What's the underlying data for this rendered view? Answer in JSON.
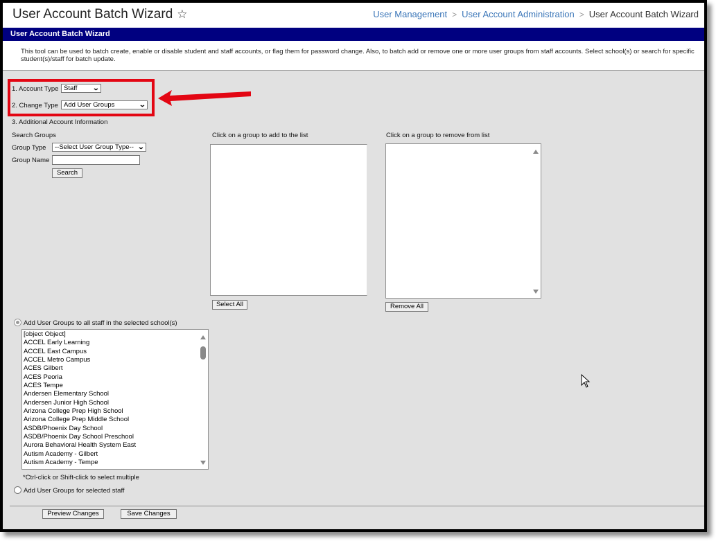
{
  "header": {
    "title": "User Account Batch Wizard",
    "favorite_icon": "star-outline-icon",
    "breadcrumb": [
      {
        "label": "User Management",
        "link": true
      },
      {
        "label": "User Account Administration",
        "link": true
      },
      {
        "label": "User Account Batch Wizard",
        "link": false
      }
    ],
    "breadcrumb_separator": ">"
  },
  "section": {
    "title": "User Account Batch Wizard",
    "header_color": "#000080",
    "description": "This tool can be used to batch create, enable or disable student and staff accounts, or flag them for password change. Also, to batch add or remove one or more user groups from staff accounts. Select school(s) or search for specific student(s)/staff for batch update."
  },
  "form": {
    "account_type": {
      "label": "1. Account Type",
      "value": "Staff"
    },
    "change_type": {
      "label": "2. Change Type",
      "value": "Add User Groups"
    },
    "additional_info_label": "3. Additional Account Information",
    "search_groups": {
      "title": "Search Groups",
      "group_type_label": "Group Type",
      "group_type_value": "--Select User Group Type--",
      "group_name_label": "Group Name",
      "group_name_value": "",
      "search_button": "Search"
    },
    "add_list": {
      "label": "Click on a group to add to the list",
      "button": "Select All",
      "items": []
    },
    "remove_list": {
      "label": "Click on a group to remove from list",
      "button": "Remove All",
      "items": []
    },
    "scope_options": [
      {
        "label": "Add User Groups to all staff in the selected school(s)",
        "checked": true
      },
      {
        "label": "Add User Groups for selected staff",
        "checked": false
      }
    ],
    "schools": [
      "[object Object]",
      "ACCEL Early Learning",
      "ACCEL East Campus",
      "ACCEL Metro Campus",
      "ACES Gilbert",
      "ACES Peoria",
      "ACES Tempe",
      "Andersen Elementary School",
      "Andersen Junior High School",
      "Arizona College Prep High School",
      "Arizona College Prep Middle School",
      "ASDB/Phoenix Day School",
      "ASDB/Phoenix Day School Preschool",
      "Aurora Behavioral Health System East",
      "Autism Academy - Gilbert",
      "Autism Academy - Tempe"
    ],
    "multi_select_hint": "*Ctrl-click or Shift-click to select multiple"
  },
  "actions": {
    "preview": "Preview Changes",
    "save": "Save Changes"
  },
  "annotation": {
    "highlight_color": "#e30613",
    "arrow_color": "#e30613"
  }
}
